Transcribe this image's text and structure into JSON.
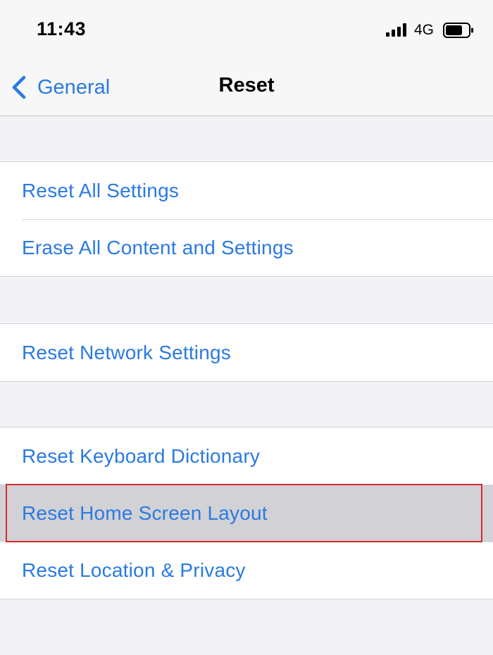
{
  "status_bar": {
    "time": "11:43",
    "network": "4G",
    "icons": [
      "signal-bars-icon",
      "battery-icon"
    ]
  },
  "nav": {
    "back_label": "General",
    "title": "Reset",
    "back_icon": "chevron-left-icon"
  },
  "groups": [
    {
      "items": [
        {
          "label": "Reset All Settings"
        },
        {
          "label": "Erase All Content and Settings"
        }
      ]
    },
    {
      "items": [
        {
          "label": "Reset Network Settings"
        }
      ]
    },
    {
      "items": [
        {
          "label": "Reset Keyboard Dictionary"
        },
        {
          "label": "Reset Home Screen Layout",
          "selected": true
        },
        {
          "label": "Reset Location & Privacy"
        }
      ]
    }
  ],
  "colors": {
    "accent": "#2a7ae2",
    "background": "#f2f2f7",
    "selected_row": "#d1d1d6",
    "highlight_outline": "#d62a2a"
  }
}
